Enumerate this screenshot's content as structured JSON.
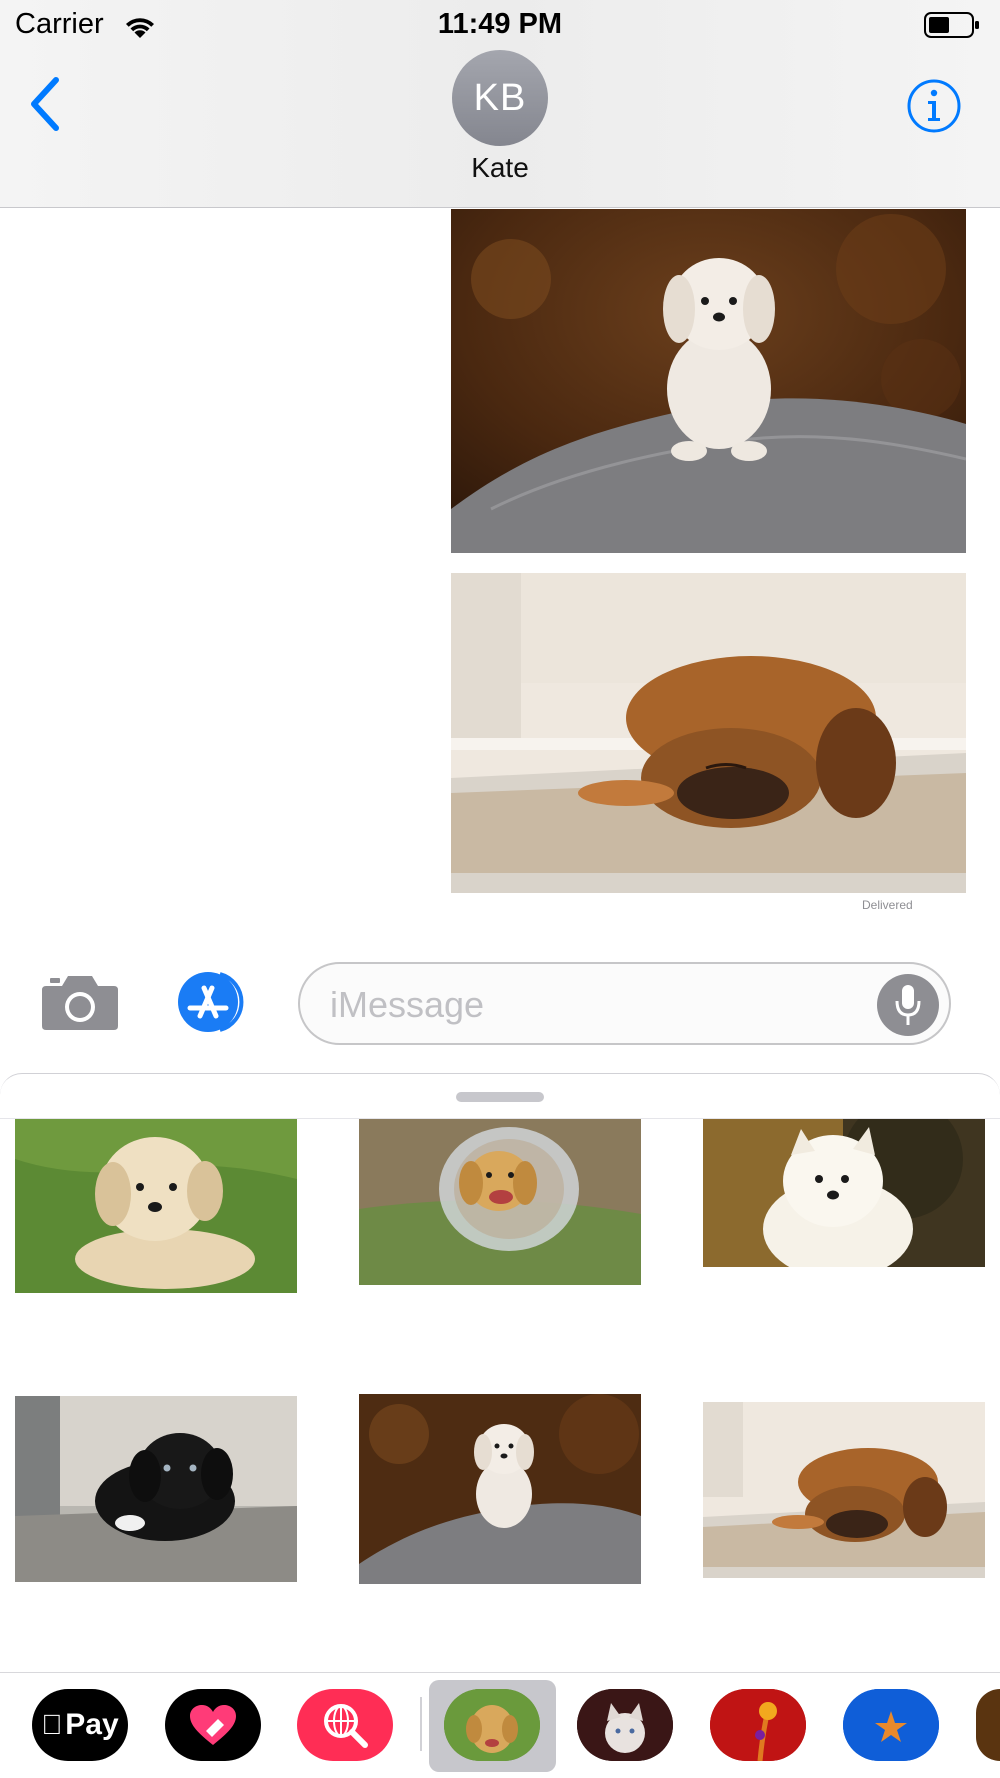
{
  "status_bar": {
    "carrier": "Carrier",
    "time": "11:49 PM"
  },
  "header": {
    "avatar_initials": "KB",
    "contact_name": "Kate"
  },
  "conversation": {
    "delivered_label": "Delivered"
  },
  "compose": {
    "placeholder": "iMessage"
  },
  "app_strip": {
    "apple_pay_label": "Pay"
  },
  "colors": {
    "accent": "#007aff",
    "avatar": "#8e9098",
    "drawer_bg": "#ffffff"
  }
}
